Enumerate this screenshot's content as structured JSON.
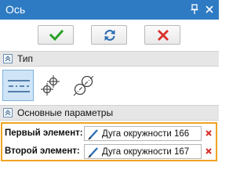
{
  "window": {
    "title": "Ось"
  },
  "actions": {
    "ok": "confirm",
    "refresh": "refresh",
    "cancel": "cancel"
  },
  "sections": {
    "type": {
      "label": "Тип"
    },
    "main_params": {
      "label": "Основные параметры"
    }
  },
  "type_options": [
    {
      "icon": "axis-by-two-points-icon",
      "selected": true
    },
    {
      "icon": "axis-by-points-icon",
      "selected": false
    },
    {
      "icon": "axis-by-circles-icon",
      "selected": false
    }
  ],
  "params": {
    "first": {
      "label": "Первый элемент:",
      "value": "Дуга окружности 166"
    },
    "second": {
      "label": "Второй элемент:",
      "value": "Дуга окружности 167"
    }
  },
  "colors": {
    "titlebar": "#2e7bc4",
    "accent_ok": "#2aa12a",
    "accent_refresh": "#2f6fb5",
    "accent_cancel": "#d9312b",
    "highlight_border": "#f0a322",
    "selected_bg": "#cfe5f7"
  }
}
